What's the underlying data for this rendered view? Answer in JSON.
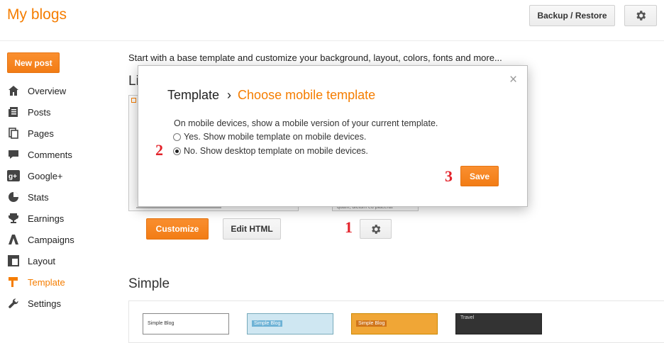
{
  "header": {
    "title": "My blogs",
    "backup_label": "Backup / Restore",
    "settings_icon": "gear-icon"
  },
  "sidebar": {
    "new_post": "New post",
    "items": [
      {
        "label": "Overview",
        "icon": "bar-chart-icon"
      },
      {
        "label": "Posts",
        "icon": "posts-icon"
      },
      {
        "label": "Pages",
        "icon": "pages-icon"
      },
      {
        "label": "Comments",
        "icon": "comment-icon"
      },
      {
        "label": "Google+",
        "icon": "google-plus-icon"
      },
      {
        "label": "Stats",
        "icon": "pie-chart-icon"
      },
      {
        "label": "Earnings",
        "icon": "trophy-icon"
      },
      {
        "label": "Campaigns",
        "icon": "adwords-icon"
      },
      {
        "label": "Layout",
        "icon": "layout-icon"
      },
      {
        "label": "Template",
        "icon": "template-icon"
      },
      {
        "label": "Settings",
        "icon": "wrench-icon"
      }
    ],
    "active_index": 9
  },
  "main": {
    "intro": "Start with a base template and customize your background, layout, colors, fonts and more...",
    "live_heading_partial": "Li",
    "customize_label": "Customize",
    "edit_html_label": "Edit HTML",
    "mobile_thumb_text": "quam, dictum eu placerat",
    "simple_heading": "Simple",
    "simple_thumbs": [
      "Simple Blog",
      "Simple Blog",
      "Simple Blog",
      "Travel"
    ]
  },
  "modal": {
    "breadcrumb_root": "Template",
    "breadcrumb_sep": "›",
    "breadcrumb_current": "Choose mobile template",
    "close": "×",
    "description": "On mobile devices, show a mobile version of your current template.",
    "option_yes": "Yes. Show mobile template on mobile devices.",
    "option_no": "No. Show desktop template on mobile devices.",
    "selected": "no",
    "save_label": "Save"
  },
  "steps": {
    "one": "1",
    "two": "2",
    "three": "3"
  },
  "colors": {
    "accent": "#f57d00",
    "step": "#e3232b"
  }
}
